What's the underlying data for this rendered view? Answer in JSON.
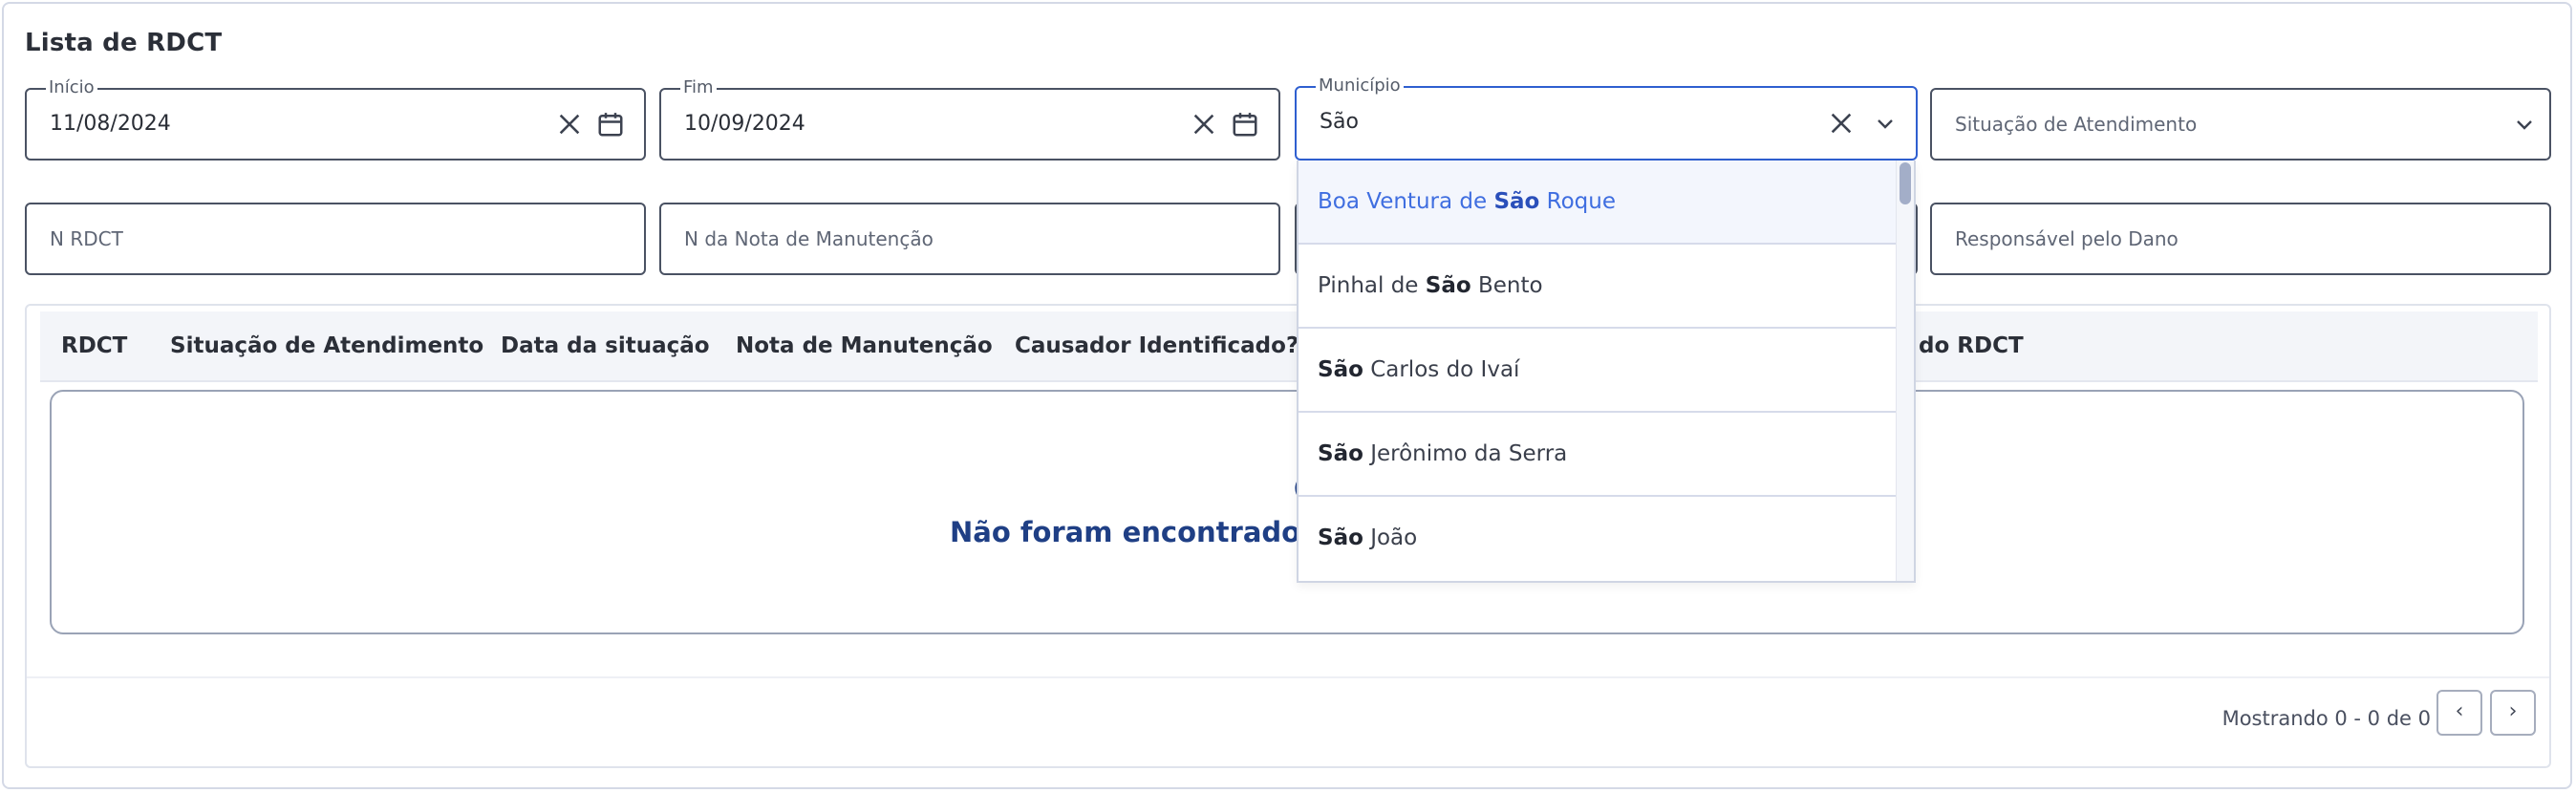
{
  "page": {
    "title": "Lista de RDCT"
  },
  "filters": {
    "inicio": {
      "label": "Início",
      "value": "11/08/2024"
    },
    "fim": {
      "label": "Fim",
      "value": "10/09/2024"
    },
    "municipio": {
      "label": "Município",
      "value": "São"
    },
    "situacao_atendimento": {
      "placeholder": "Situação de Atendimento"
    },
    "n_rdct": {
      "placeholder": "N RDCT"
    },
    "n_nota_manutencao": {
      "placeholder": "N da Nota de Manutenção"
    },
    "responsavel_dano": {
      "placeholder": "Responsável pelo Dano"
    }
  },
  "icons": {
    "clear": "close-icon",
    "calendar": "calendar-icon",
    "dropdown": "chevron-down-icon",
    "info": "info-icon",
    "prev": "chevron-left-icon",
    "next": "chevron-right-icon"
  },
  "municipio_dropdown": {
    "query": "São",
    "options": [
      {
        "before": "Boa Ventura de ",
        "match": "São",
        "after": " Roque",
        "highlighted": true
      },
      {
        "before": "Pinhal de ",
        "match": "São",
        "after": " Bento",
        "highlighted": false
      },
      {
        "before": "",
        "match": "São",
        "after": " Carlos do Ivaí",
        "highlighted": false
      },
      {
        "before": "",
        "match": "São",
        "after": " Jerônimo da Serra",
        "highlighted": false
      },
      {
        "before": "",
        "match": "São",
        "after": " João",
        "highlighted": false
      }
    ]
  },
  "table": {
    "columns": [
      "RDCT",
      "Situação de Atendimento",
      "Data da situação",
      "Nota de Manutenção",
      "Causador Identificado?",
      "do RDCT"
    ],
    "empty_message": "Não foram encontrados re"
  },
  "pagination": {
    "status": "Mostrando 0 - 0 de 0",
    "prev_label": "‹",
    "next_label": "›"
  },
  "colors": {
    "accent": "#2f5fd0",
    "empty_text": "#1f3f85",
    "highlight_option": "#3f6ee0"
  }
}
